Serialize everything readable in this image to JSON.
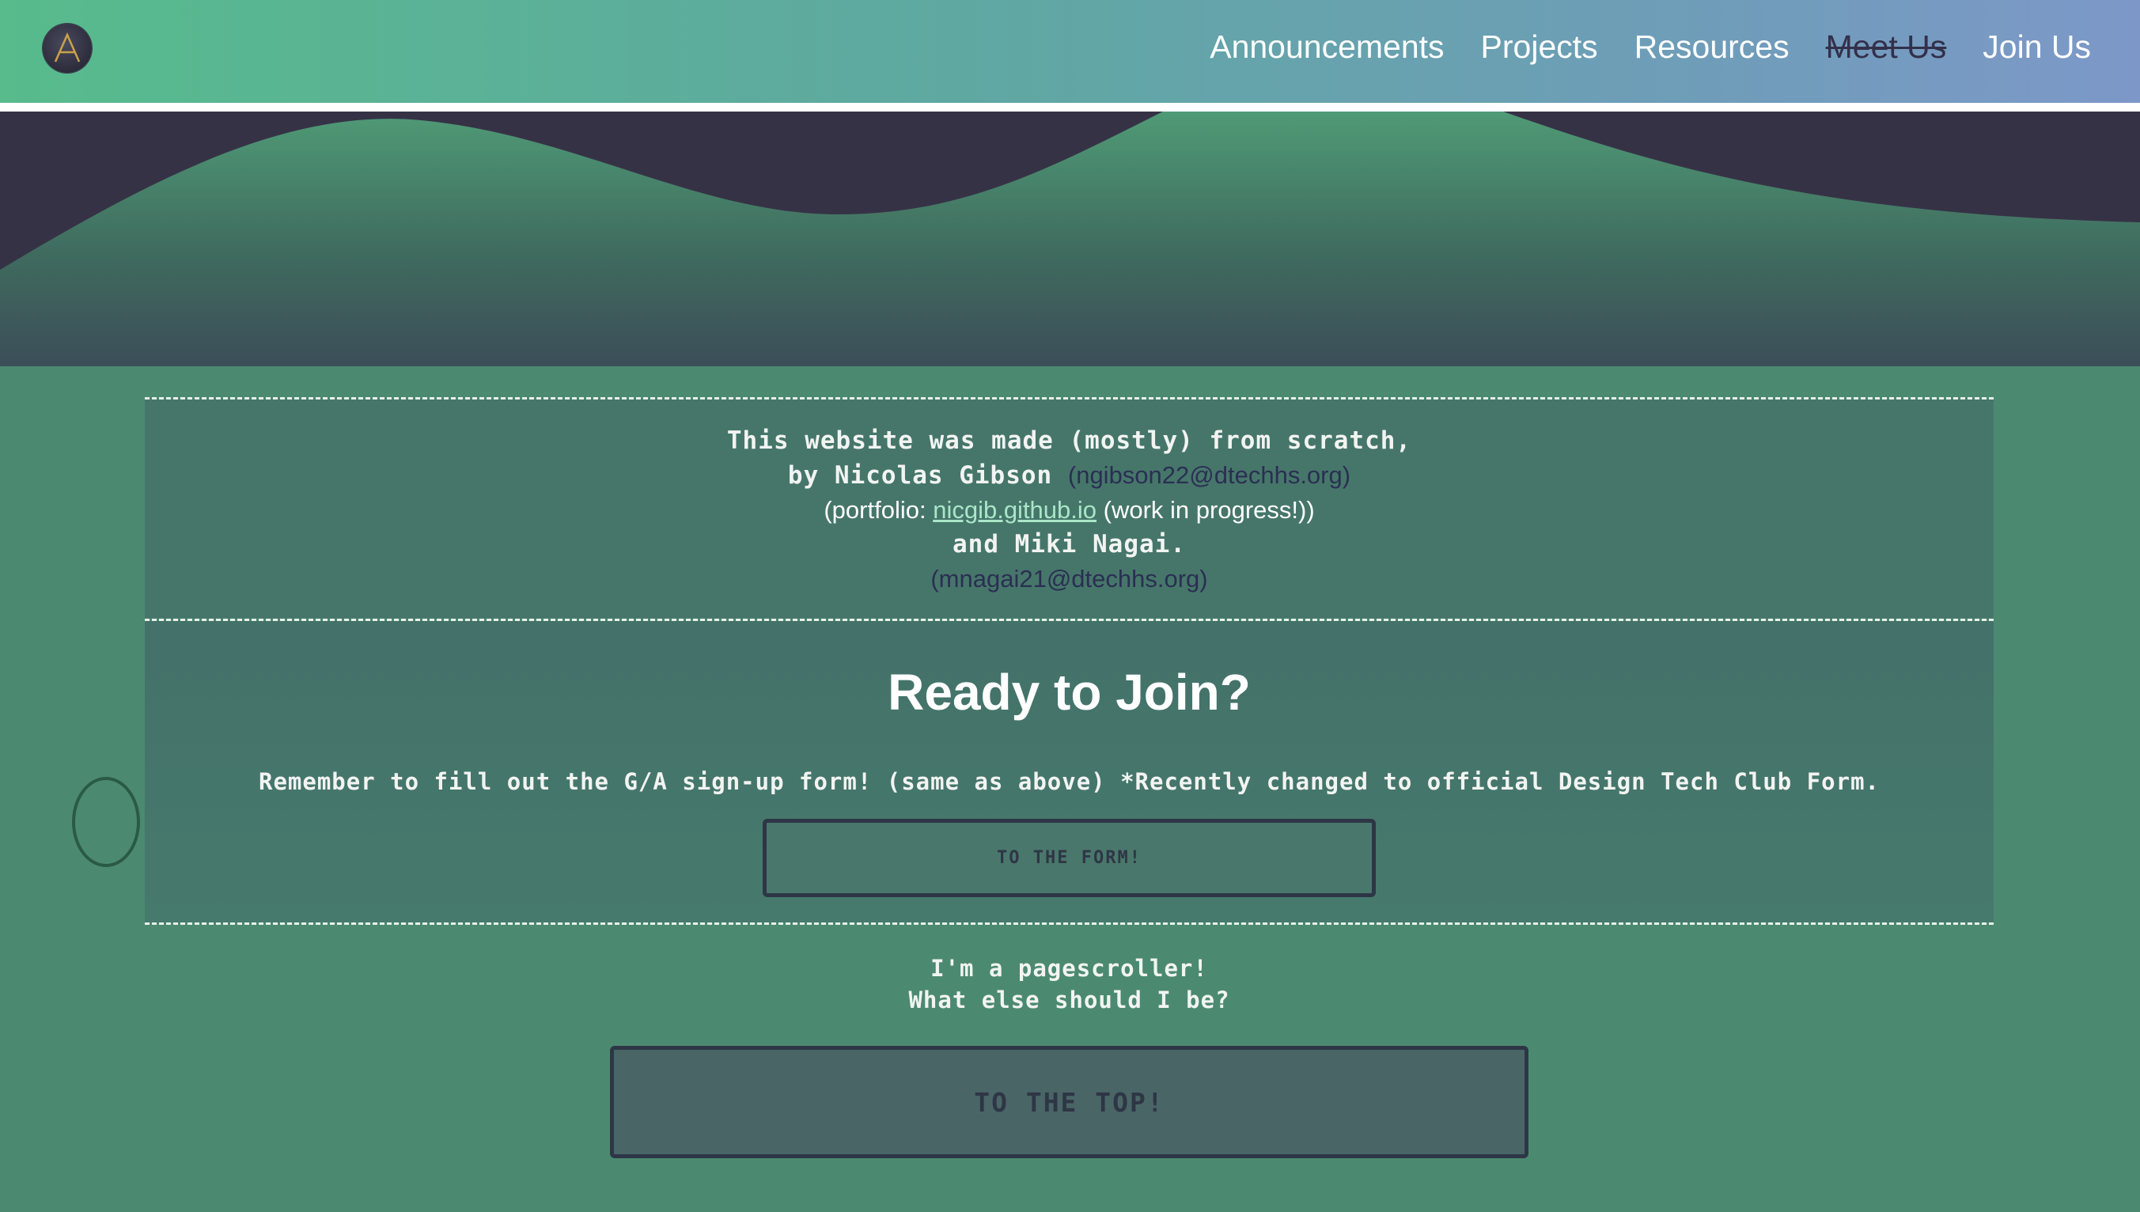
{
  "header": {
    "logo_icon": "design-tech-logo",
    "nav": [
      {
        "label": "Announcements"
      },
      {
        "label": "Projects"
      },
      {
        "label": "Resources"
      },
      {
        "label": "Meet Us",
        "struck": true
      },
      {
        "label": "Join Us"
      }
    ]
  },
  "credits": {
    "line1": "This website was made (mostly) from scratch,",
    "line2_prefix": "by Nicolas Gibson ",
    "line2_email": "(ngibson22@dtechhs.org)",
    "line3_prefix": "(portfolio: ",
    "line3_link": "nicgib.github.io",
    "line3_suffix": " (work in progress!))",
    "line4": "and Miki Nagai.",
    "line5_email": "(mnagai21@dtechhs.org)"
  },
  "join": {
    "title": "Ready to Join?",
    "reminder": "Remember to fill out the G/A sign-up form! (same as above) *Recently changed to official Design Tech Club Form.",
    "form_button": "TO THE FORM!"
  },
  "scroller": {
    "line1": "I'm a pagescroller!",
    "line2": "What else should I be?",
    "top_button": "TO THE TOP!"
  },
  "colors": {
    "header_gradient_start": "#57bb8c",
    "header_gradient_end": "#7d98c8",
    "page_bg": "#4b8a70",
    "panel_bg": "#46766a",
    "dark_navy": "#33304a"
  }
}
